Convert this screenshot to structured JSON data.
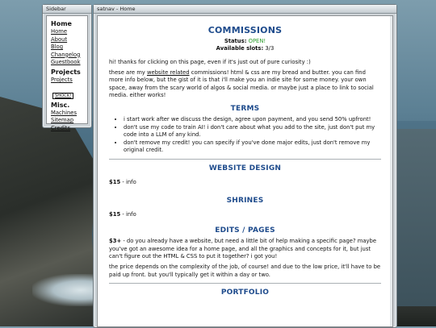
{
  "sidebar": {
    "title": "Sidebar",
    "sections": [
      {
        "heading": "Home",
        "links": [
          "Home",
          "About",
          "Blog",
          "Changelog",
          "Guestbook"
        ]
      },
      {
        "heading": "Projects",
        "links": [
          "Projects"
        ],
        "badge": "SHOCK!"
      },
      {
        "heading": "Misc.",
        "links": [
          "Machines",
          "Sitemap",
          "Credits"
        ]
      }
    ]
  },
  "main": {
    "title": "satnav - Home",
    "commissions": {
      "heading": "COMMISSIONS",
      "status_label": "Status:",
      "status_value": "OPEN!",
      "slots_label": "Available slots:",
      "slots_value": "3/3",
      "intro1": "hi! thanks for clicking on this page, even if it's just out of pure curiosity :)",
      "intro2_a": "these are my ",
      "intro2_link": "website related",
      "intro2_b": " commissions! html & css are my bread and butter. you can find more info below, but the gist of it is that i'll make you an indie site for some money. your own space, away from the scary world of algos & social media. or maybe just a place to link to social media. either works!"
    },
    "terms": {
      "heading": "TERMS",
      "items": [
        "i start work after we discuss the design, agree upon payment, and you send 50% upfront!",
        "don't use my code to train AI! i don't care about what you add to the site, just don't put my code into a LLM of any kind.",
        "don't remove my credit! you can specify if you've done major edits, just don't remove my original credit."
      ]
    },
    "website_design": {
      "heading": "WEBSITE DESIGN",
      "price": "$15",
      "rest": " - info"
    },
    "shrines": {
      "heading": "SHRINES",
      "price": "$15",
      "rest": " - info"
    },
    "edits": {
      "heading": "EDITS / PAGES",
      "price": "$3+",
      "text1": " - do you already have a website, but need a little bit of help making a specific page? maybe you've got an awesome idea for a home page, and all the graphics and concepts for it, but just can't figure out the HTML & CSS to put it together? i got you!",
      "text2": "the price depends on the complexity of the job, of course! and due to the low price, it'll have to be paid up front. but you'll typically get it within a day or two."
    },
    "portfolio": {
      "heading": "PORTFOLIO"
    }
  }
}
